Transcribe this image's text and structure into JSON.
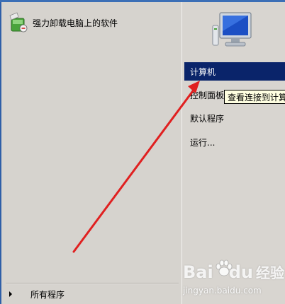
{
  "left_pane": {
    "pinned": {
      "label": "强力卸载电脑上的软件",
      "icon": "software-uninstaller-icon"
    },
    "all_programs": {
      "label": "所有程序",
      "icon": "right-arrow-icon"
    }
  },
  "right_pane": {
    "header_icon": "monitor-icon",
    "items": [
      {
        "label": "计算机",
        "highlighted": true
      },
      {
        "label": "控制面板"
      },
      {
        "label": "默认程序"
      },
      {
        "label": "运行..."
      }
    ],
    "tooltip": "查看连接到计算"
  },
  "annotation": {
    "arrow_color": "#e02020"
  },
  "watermark": {
    "brand_left": "Bai",
    "brand_right": "du",
    "brand_cn": "经验",
    "url": "jingyan.baidu.com"
  },
  "colors": {
    "highlight": "#0a246a",
    "pane_bg": "#d6d3ce",
    "tooltip_bg": "#ffffe1"
  }
}
